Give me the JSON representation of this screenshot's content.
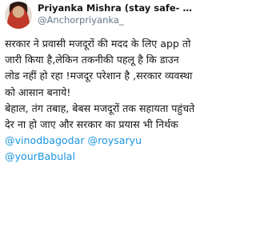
{
  "author": {
    "display_name": "Priyanka Mishra (stay safe- stay ho...",
    "handle": "@Anchorpriyanka_",
    "avatar": "user-avatar-photo"
  },
  "tweet": {
    "paragraph_1": "सरकार ने प्रवासी मजदूरों की मदद के लिए app तो जारी किया है,लेकिन तकनीकी पहलू है कि डाउन लोड नहीं हो रहा !मजदूर परेशान है ,सरकार व्यवस्था को आसान बनाये!",
    "paragraph_2": "बेहाल, तंग तबाह, बेबस मजदूरों तक सहायता पहुंचते देर ना हो जाए और सरकार का प्रयास भी निर्थक",
    "mentions": [
      "@vinodbagodar",
      "@roysaryu",
      "@yourBabulal"
    ]
  },
  "colors": {
    "text": "#14171a",
    "secondary": "#657786",
    "link": "#1b95e0"
  }
}
